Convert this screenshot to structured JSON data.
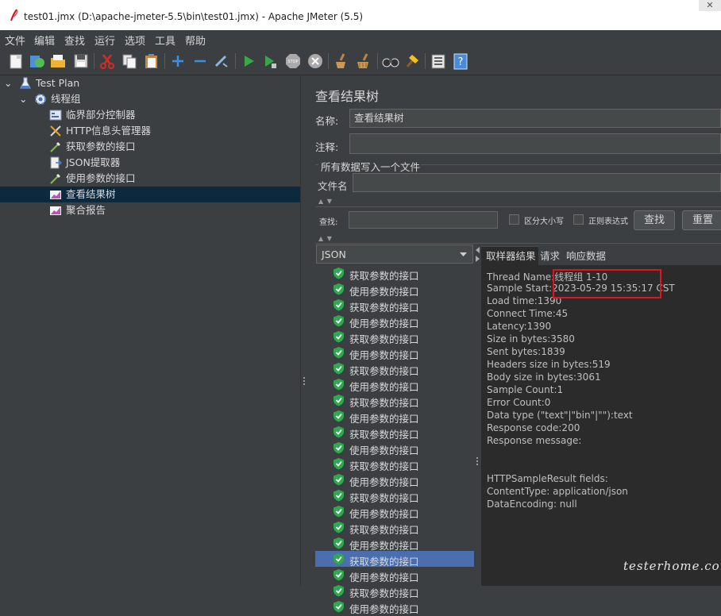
{
  "window": {
    "title": "test01.jmx (D:\\apache-jmeter-5.5\\bin\\test01.jmx) - Apache JMeter (5.5)",
    "close_glyph": "✕"
  },
  "menu": [
    "文件",
    "编辑",
    "查找",
    "运行",
    "选项",
    "工具",
    "帮助"
  ],
  "toolbar_icons": [
    "new-icon",
    "templates-icon",
    "open-icon",
    "save-icon",
    "cut-icon",
    "copy-icon",
    "paste-icon",
    "expand-icon",
    "collapse-icon",
    "toggle-icon",
    "start-icon",
    "start-no-pause-icon",
    "stop-icon",
    "shutdown-icon",
    "clear-icon",
    "clear-all-icon",
    "search-icon",
    "reset-search-icon",
    "function-helper-icon",
    "help-icon"
  ],
  "tree": [
    {
      "label": "Test Plan",
      "icon": "flask-icon",
      "depth": 0,
      "expander": "⌄"
    },
    {
      "label": "线程组",
      "icon": "gear-icon",
      "depth": 1,
      "expander": "⌄"
    },
    {
      "label": "临界部分控制器",
      "icon": "controller-icon",
      "depth": 2
    },
    {
      "label": "HTTP信息头管理器",
      "icon": "tools-icon",
      "depth": 2
    },
    {
      "label": "获取参数的接口",
      "icon": "pipette-icon",
      "depth": 2
    },
    {
      "label": "JSON提取器",
      "icon": "extractor-icon",
      "depth": 2
    },
    {
      "label": "使用参数的接口",
      "icon": "pipette-icon",
      "depth": 2
    },
    {
      "label": "查看结果树",
      "icon": "chart-icon",
      "depth": 2,
      "selected": true
    },
    {
      "label": "聚合报告",
      "icon": "chart-icon",
      "depth": 2
    }
  ],
  "panel": {
    "title": "查看结果树",
    "name_label": "名称:",
    "name_value": "查看结果树",
    "comment_label": "注释:",
    "comment_value": "",
    "file_section": "所有数据写入一个文件",
    "filename_label": "文件名",
    "filename_value": "",
    "search_label": "查找:",
    "search_value": "",
    "case_sensitive": "区分大小写",
    "regex": "正则表达式",
    "find_button": "查找",
    "reset_button": "重置",
    "renderer": "JSON",
    "expand_arrows": "▲ ▼"
  },
  "results": [
    "获取参数的接口",
    "使用参数的接口",
    "获取参数的接口",
    "使用参数的接口",
    "获取参数的接口",
    "使用参数的接口",
    "获取参数的接口",
    "使用参数的接口",
    "获取参数的接口",
    "使用参数的接口",
    "获取参数的接口",
    "使用参数的接口",
    "获取参数的接口",
    "使用参数的接口",
    "获取参数的接口",
    "使用参数的接口",
    "获取参数的接口",
    "使用参数的接口",
    "获取参数的接口",
    "使用参数的接口",
    "获取参数的接口",
    "使用参数的接口"
  ],
  "selected_result_index": 18,
  "tabs": [
    "取样器结果",
    "请求",
    "响应数据"
  ],
  "detail_lines": [
    "Thread Name:线程组 1-10",
    "Sample Start:2023-05-29 15:35:17 CST",
    "Load time:1390",
    "Connect Time:45",
    "Latency:1390",
    "Size in bytes:3580",
    "Sent bytes:1839",
    "Headers size in bytes:519",
    "Body size in bytes:3061",
    "Sample Count:1",
    "Error Count:0",
    "Data type (\"text\"|\"bin\"|\"\"):text",
    "Response code:200",
    "Response message:",
    "",
    "",
    "HTTPSampleResult fields:",
    "ContentType: application/json",
    "DataEncoding: null"
  ],
  "watermark": "testerhome.com",
  "colors": {
    "background": "#3c3f41",
    "selection": "#4b6eaf",
    "tree_selection": "#0d293e",
    "highlight": "#e0141e",
    "success": "#2fa84f"
  }
}
